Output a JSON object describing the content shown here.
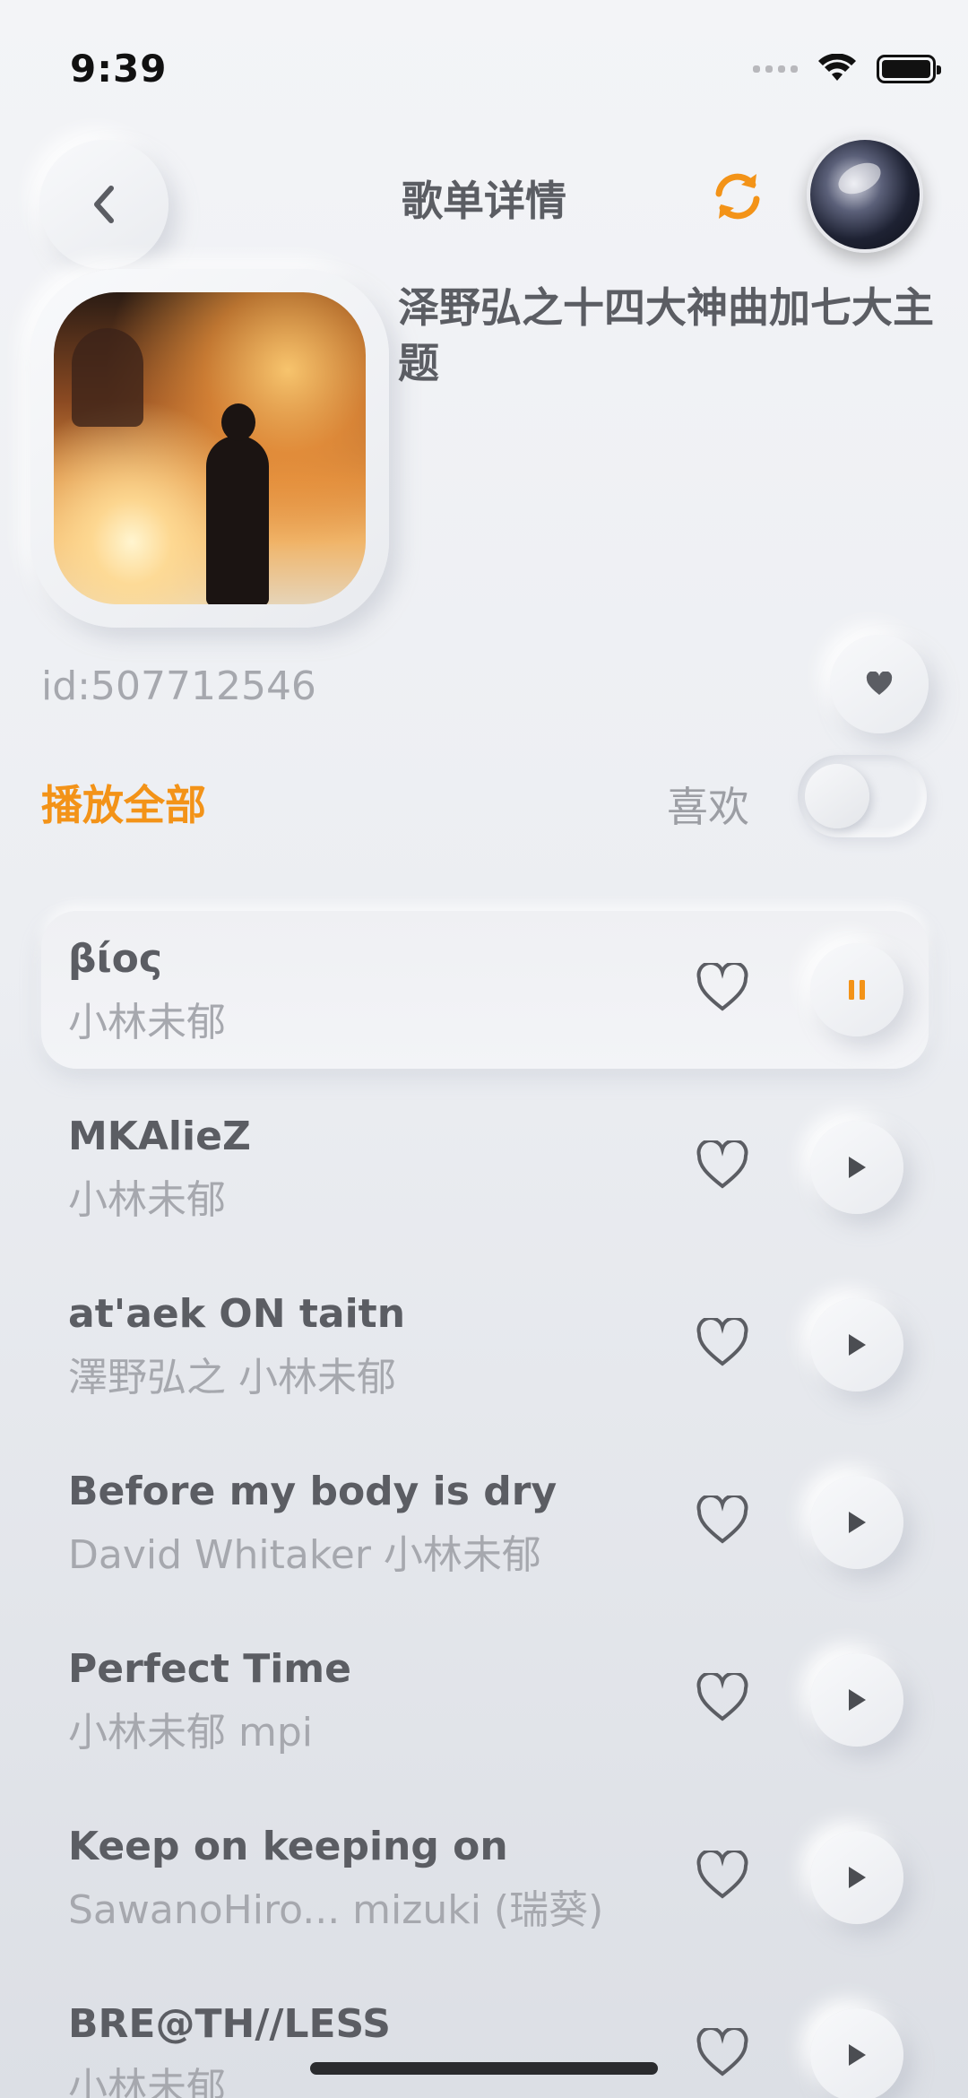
{
  "status_bar": {
    "time": "9:39"
  },
  "header": {
    "title": "歌单详情",
    "back_icon": "chevron-left-icon",
    "refresh_icon": "refresh-icon",
    "accent_color": "#f39318"
  },
  "playlist": {
    "name": "泽野弘之十四大神曲加七大主题",
    "id_text": "id:507712546"
  },
  "actions": {
    "play_all": "播放全部",
    "like_label": "喜欢",
    "like_toggle_on": false
  },
  "songs": [
    {
      "title": "βίος",
      "artist": "小林未郁",
      "state": "playing"
    },
    {
      "title": "MKAlieZ",
      "artist": "小林未郁",
      "state": "paused"
    },
    {
      "title": "at'aek ON taitn",
      "artist": "澤野弘之  小林未郁",
      "state": "paused"
    },
    {
      "title": "Before my body is dry",
      "artist": "David Whitaker  小林未郁",
      "state": "paused"
    },
    {
      "title": "Perfect Time",
      "artist": "小林未郁  mpi",
      "state": "paused"
    },
    {
      "title": "Keep on keeping on",
      "artist": "SawanoHiro...  mizuki (瑞葵)",
      "state": "paused"
    },
    {
      "title": "BRE@TH//LESS",
      "artist": "小林未郁",
      "state": "paused"
    }
  ]
}
